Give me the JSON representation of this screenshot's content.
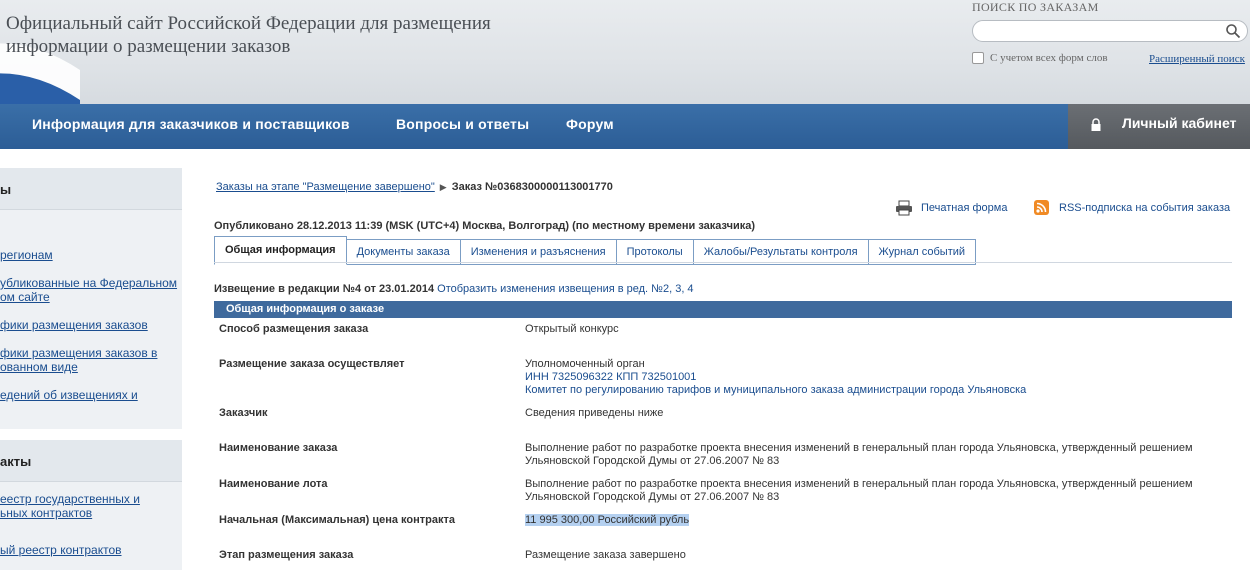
{
  "header": {
    "site_title": "Официальный сайт Российской Федерации для размещения информации о размещении заказов",
    "search_title": "ПОИСК ПО ЗАКАЗАМ",
    "search_placeholder": "",
    "morph_label": "С учетом всех форм слов",
    "advanced_search": "Расширенный поиск"
  },
  "nav": {
    "items": [
      "Информация для заказчиков и поставщиков",
      "Вопросы и ответы",
      "Форум"
    ],
    "cabinet": "Личный кабинет"
  },
  "sidebar": {
    "box1": {
      "title": "ы",
      "links": [
        "регионам",
        "убликованные на Федеральном\nом сайте",
        "фики размещения заказов",
        "фики размещения заказов в\nованном виде",
        "едений об извещениях и"
      ]
    },
    "box2": {
      "title": "акты",
      "links": [
        "еестр государственных и\nьных контрактов",
        "ый реестр контрактов"
      ]
    }
  },
  "breadcrumb": {
    "parent": "Заказы на этапе \"Размещение завершено\"",
    "current": "Заказ №0368300000113001770"
  },
  "actions": {
    "print": "Печатная форма",
    "rss": "RSS-подписка на события заказа"
  },
  "published": "Опубликовано 28.12.2013 11:39 (MSK (UTC+4) Москва, Волгоград) (по местному времени заказчика)",
  "tabs": [
    "Общая информация",
    "Документы заказа",
    "Изменения и разъяснения",
    "Протоколы",
    "Жалобы/Результаты контроля",
    "Журнал событий"
  ],
  "edition": {
    "text": "Извещение в редакции №4 от 23.01.2014",
    "link": "Отобразить изменения извещения в ред. №2, 3, 4"
  },
  "section_title": "Общая информация о заказе",
  "rows": [
    {
      "label": "Способ размещения заказа",
      "value": "Открытый конкурс"
    },
    {
      "label": "Размещение заказа осуществляет",
      "value": "Уполномоченный орган",
      "link1": "ИНН 7325096322 КПП 732501001",
      "link2": "Комитет по регулированию тарифов и муниципального заказа администрации города Ульяновска"
    },
    {
      "label": "Заказчик",
      "value": "Сведения приведены ниже"
    },
    {
      "label": "Наименование заказа",
      "value": "Выполнение работ по разработке проекта внесения изменений в генеральный план города Ульяновска, утвержденный решением Ульяновской Городской Думы от 27.06.2007 № 83"
    },
    {
      "label": "Наименование лота",
      "value": "Выполнение работ по разработке проекта внесения изменений в генеральный план города Ульяновска, утвержденный решением Ульяновской Городской Думы от 27.06.2007 № 83"
    },
    {
      "label": "Начальная (Максимальная) цена контракта",
      "value": "11 995 300,00 Российский рубль"
    },
    {
      "label": "Этап размещения заказа",
      "value": "Размещение заказа завершено"
    }
  ],
  "colors": {
    "nav": "#2c5d96",
    "link": "#1a4d8f",
    "section_bar": "#3f6a9d",
    "cabinet": "#5d6166"
  }
}
